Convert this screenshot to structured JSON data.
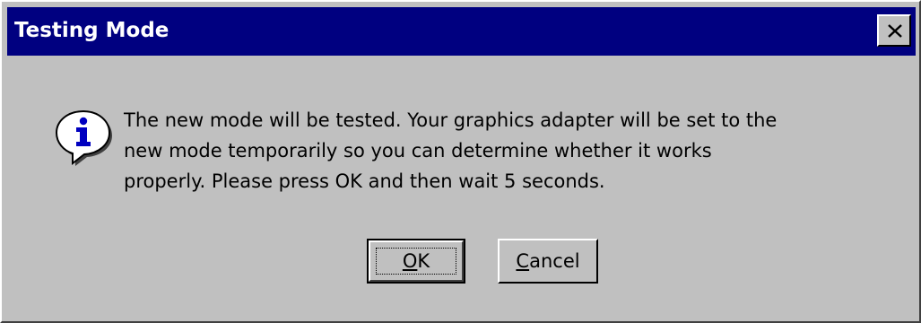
{
  "window": {
    "title": "Testing Mode",
    "close_label": "Close",
    "titlebar_color": "#000080",
    "background_color": "#c0c0c0"
  },
  "message": {
    "icon": "info-icon",
    "lines": [
      "The new mode will be tested.  Your graphics adapter will be set to the",
      "new mode temporarily so you can determine whether it works",
      "properly.  Please press OK and then wait 5 seconds."
    ]
  },
  "buttons": {
    "ok": {
      "mnemonic": "O",
      "rest": "K",
      "default": true
    },
    "cancel": {
      "mnemonic": "C",
      "rest": "ancel"
    }
  }
}
